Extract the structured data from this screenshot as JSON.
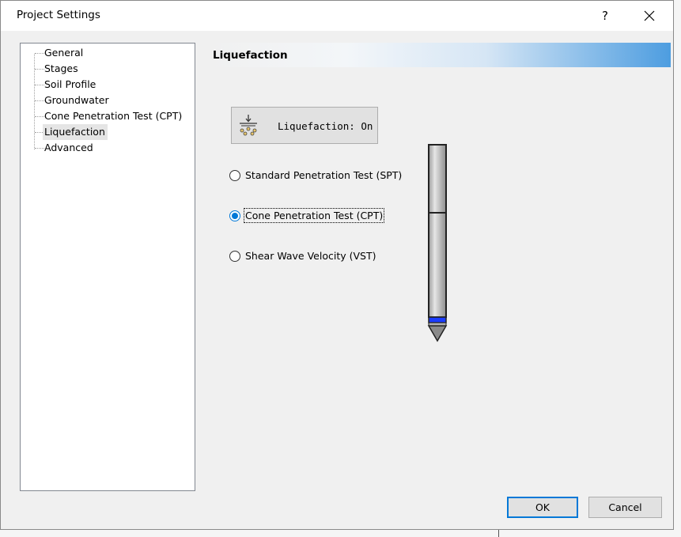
{
  "window": {
    "title": "Project Settings",
    "help_label": "?",
    "close_label": "✕"
  },
  "tree": {
    "items": [
      {
        "label": "General",
        "selected": false
      },
      {
        "label": "Stages",
        "selected": false
      },
      {
        "label": "Soil Profile",
        "selected": false
      },
      {
        "label": "Groundwater",
        "selected": false
      },
      {
        "label": "Cone Penetration Test (CPT)",
        "selected": false
      },
      {
        "label": "Liquefaction",
        "selected": true
      },
      {
        "label": "Advanced",
        "selected": false
      }
    ]
  },
  "section": {
    "title": "Liquefaction"
  },
  "toggle": {
    "label": "Liquefaction: On",
    "icon": "liquefaction-icon"
  },
  "radios": [
    {
      "label": "Standard Penetration Test (SPT)",
      "checked": false
    },
    {
      "label": "Cone Penetration Test (CPT)",
      "checked": true
    },
    {
      "label": "Shear Wave Velocity (VST)",
      "checked": false
    }
  ],
  "buttons": {
    "ok_label": "OK",
    "cancel_label": "Cancel"
  },
  "colors": {
    "accent": "#0078d7",
    "header_gradient_end": "#4d9de0",
    "probe_band": "#1a3cff"
  }
}
